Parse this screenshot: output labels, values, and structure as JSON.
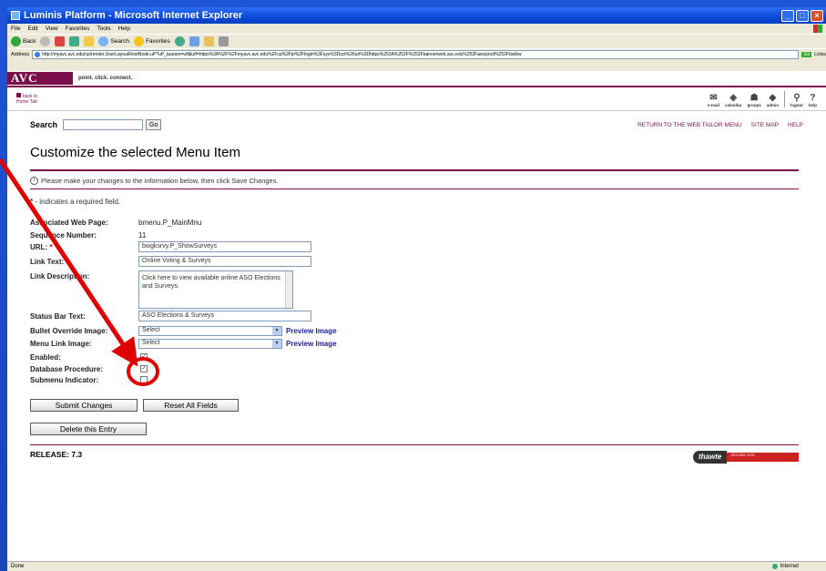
{
  "window": {
    "title": "Luminis Platform - Microsoft Internet Explorer",
    "menu": [
      "File",
      "Edit",
      "View",
      "Favorites",
      "Tools",
      "Help"
    ],
    "toolbar": [
      "Back",
      "",
      "",
      "",
      "",
      "Search",
      "Favorites"
    ],
    "address_label": "Address",
    "address_url": "http://myavc.avc.edu/cp/render.UserLayoutRootNode.uP?uP_tparam=utf&utf=https%3A%2F%2Fmyavc.avc.edu%2Fcp%2Fip%2Flogin%3Fsys%3Dsct%26url%3Dhttps%253A%252F%252Fbannerweb.avc.edu%252Fawcprod%252Fbwlkw",
    "go_label": "Go",
    "links_label": "Links",
    "status_left": "Done",
    "status_zone": "Internet"
  },
  "site": {
    "logo_text": "AVC",
    "tagline": "point. click. connect.",
    "back_line1": "back to",
    "back_line2": "Home Tab",
    "nav_icons": [
      {
        "label": "e-mail",
        "glyph": "✉"
      },
      {
        "label": "calendar",
        "glyph": "◈"
      },
      {
        "label": "groups",
        "glyph": "☗"
      },
      {
        "label": "admin",
        "glyph": "◆"
      },
      {
        "label": "logout",
        "glyph": "⚲"
      },
      {
        "label": "help",
        "glyph": "?"
      }
    ]
  },
  "search": {
    "label": "Search",
    "value": "",
    "go": "Go"
  },
  "top_links": [
    "RETURN TO THE WEB TAILOR MENU",
    "SITE MAP",
    "HELP"
  ],
  "page_title": "Customize the selected Menu Item",
  "instructions": "Please make your changes to the information below, then click Save Changes.",
  "required_note": "- indicates a required field.",
  "form": {
    "associated_label": "Associated Web Page:",
    "associated_value": "bmenu.P_MainMnu",
    "sequence_label": "Sequence Number:",
    "sequence_value": "11",
    "url_label": "URL:",
    "url_value": "bwgksrvy.P_ShowSurveys",
    "link_text_label": "Link Text:",
    "link_text_value": "Online Voting & Surveys",
    "link_desc_label": "Link Description:",
    "link_desc_value": "Click here to view available online ASO Elections and Surveys.",
    "status_bar_label": "Status Bar Text:",
    "status_bar_value": "ASO Elections & Surveys",
    "bullet_label": "Bullet Override Image:",
    "bullet_value": "Select",
    "menu_link_label": "Menu Link Image:",
    "menu_link_value": "Select",
    "preview_label": "Preview Image",
    "enabled_label": "Enabled:",
    "db_proc_label": "Database Procedure:",
    "submenu_label": "Submenu Indicator:",
    "enabled_checked": true,
    "db_proc_checked": true,
    "submenu_checked": false
  },
  "buttons": {
    "submit": "Submit Changes",
    "reset": "Reset All Fields",
    "delete": "Delete this Entry"
  },
  "release": "RELEASE: 7.3",
  "thawte": {
    "brand": "thawte",
    "badge": "SECURE SITE"
  },
  "colors": {
    "accent": "#7a0e4a",
    "annotation": "#e00000",
    "slide_bg": "#1d4fc7"
  }
}
